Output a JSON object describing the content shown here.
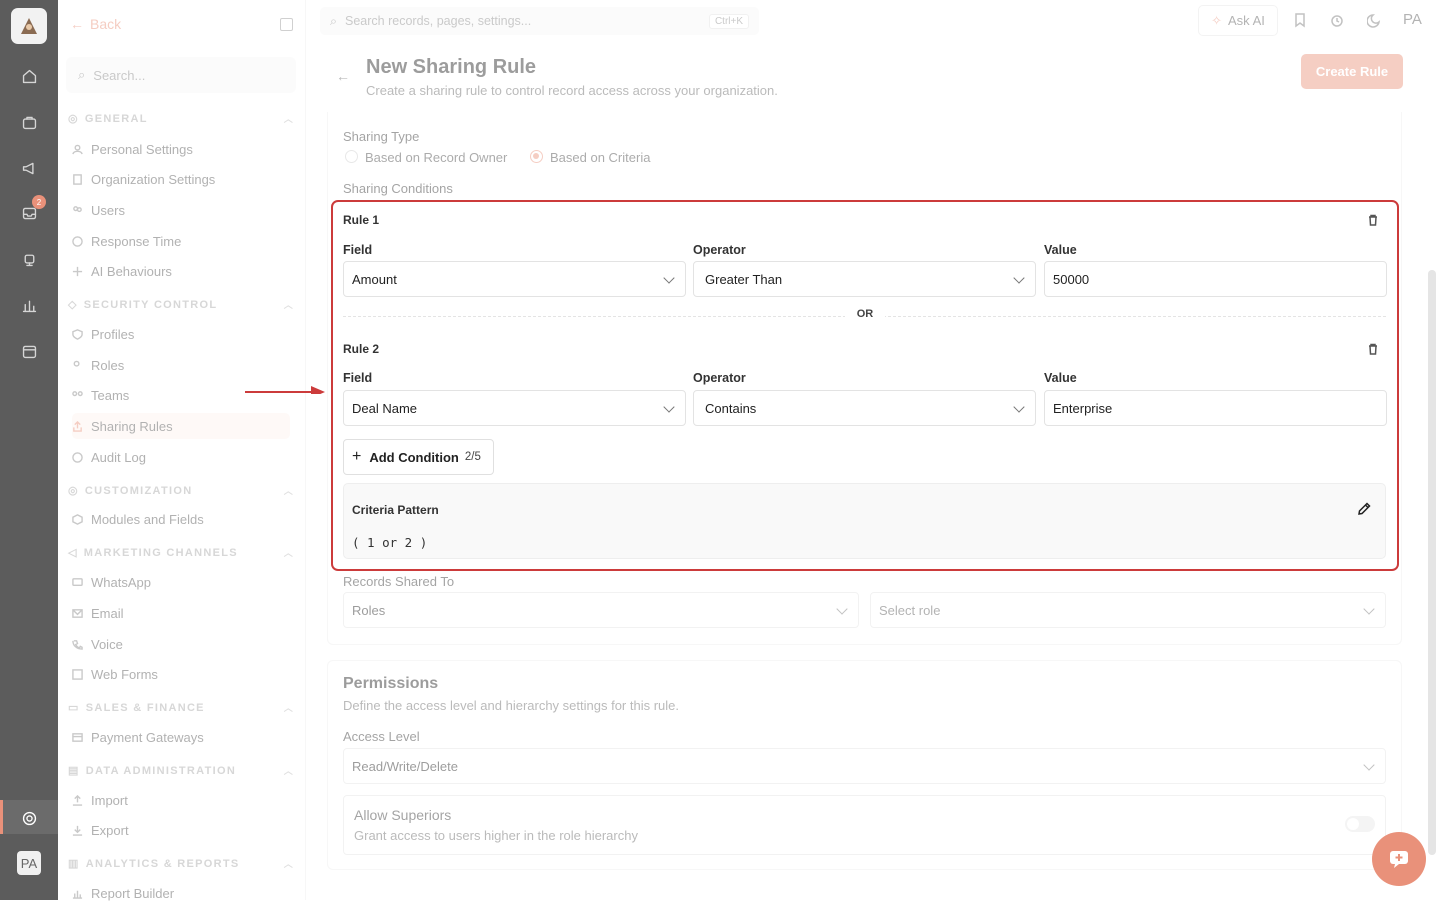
{
  "rail": {
    "badge_count": "2",
    "avatar": "PA"
  },
  "sidebar": {
    "back_label": "Back",
    "search_placeholder": "Search...",
    "sections": {
      "general": "GENERAL",
      "security": "SECURITY CONTROL",
      "customization": "CUSTOMIZATION",
      "marketing": "MARKETING CHANNELS",
      "sales": "SALES & FINANCE",
      "data_admin": "DATA ADMINISTRATION",
      "analytics": "ANALYTICS & REPORTS"
    },
    "items": {
      "personal": "Personal Settings",
      "organization": "Organization Settings",
      "users": "Users",
      "response": "Response Time",
      "ai": "AI Behaviours",
      "profiles": "Profiles",
      "roles": "Roles",
      "teams": "Teams",
      "sharing": "Sharing Rules",
      "audit": "Audit Log",
      "modules": "Modules and Fields",
      "whatsapp": "WhatsApp",
      "email": "Email",
      "voice": "Voice",
      "webforms": "Web Forms",
      "payment": "Payment Gateways",
      "import": "Import",
      "export": "Export",
      "report": "Report Builder"
    }
  },
  "topbar": {
    "search_placeholder": "Search records, pages, settings...",
    "shortcut": "Ctrl+K",
    "ask_ai": "Ask AI",
    "avatar": "PA"
  },
  "header": {
    "title": "New Sharing Rule",
    "subtitle": "Create a sharing rule to control record access across your organization.",
    "create_button": "Create Rule"
  },
  "form": {
    "sharing_type_label": "Sharing Type",
    "option_owner": "Based on Record Owner",
    "option_criteria": "Based on Criteria",
    "conditions_label": "Sharing Conditions",
    "field_label": "Field",
    "operator_label": "Operator",
    "value_label": "Value",
    "rules": [
      {
        "title": "Rule 1",
        "field": "Amount",
        "operator": "Greater Than",
        "value": "50000"
      },
      {
        "title": "Rule 2",
        "field": "Deal Name",
        "operator": "Contains",
        "value": "Enterprise"
      }
    ],
    "or_label": "OR",
    "add_condition": "Add Condition",
    "condition_count": "2/5",
    "criteria_pattern_label": "Criteria Pattern",
    "criteria_pattern_value": "( 1 or 2 )",
    "records_shared_label": "Records Shared To",
    "shared_type": "Roles",
    "select_role_placeholder": "Select role"
  },
  "permissions": {
    "title": "Permissions",
    "subtitle": "Define the access level and hierarchy settings for this rule.",
    "access_label": "Access Level",
    "access_value": "Read/Write/Delete",
    "superiors_title": "Allow Superiors",
    "superiors_desc": "Grant access to users higher in the role hierarchy",
    "superiors_enabled": false
  },
  "colors": {
    "accent": "#e9917a",
    "highlight": "#cc3b3b",
    "rail": "#5c5c5c"
  }
}
